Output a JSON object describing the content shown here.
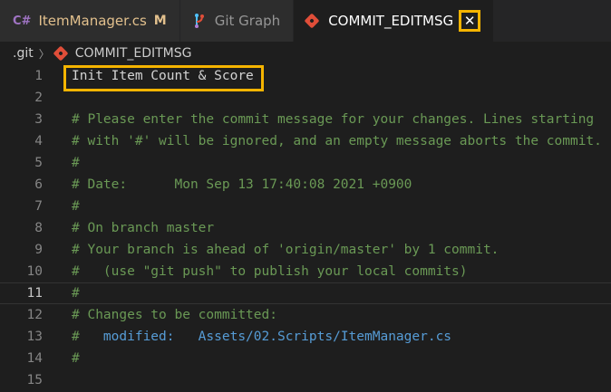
{
  "tabs": [
    {
      "icon": "C#",
      "label": "ItemManager.cs",
      "badge": "M"
    },
    {
      "label": "Git Graph"
    },
    {
      "label": "COMMIT_EDITMSG",
      "close": "✕"
    }
  ],
  "breadcrumb": {
    "folder": ".git",
    "separator": "〉",
    "file": "COMMIT_EDITMSG"
  },
  "editor": {
    "current_line": 11,
    "lines": [
      {
        "n": "1",
        "text": "Init Item Count & Score"
      },
      {
        "n": "2",
        "text": ""
      },
      {
        "n": "3",
        "text": "# Please enter the commit message for your changes. Lines starting"
      },
      {
        "n": "4",
        "text": "# with '#' will be ignored, and an empty message aborts the commit."
      },
      {
        "n": "5",
        "text": "#"
      },
      {
        "n": "6",
        "text": "# Date:      Mon Sep 13 17:40:08 2021 +0900"
      },
      {
        "n": "7",
        "text": "#"
      },
      {
        "n": "8",
        "text": "# On branch master"
      },
      {
        "n": "9",
        "text": "# Your branch is ahead of 'origin/master' by 1 commit."
      },
      {
        "n": "10",
        "text": "#   (use \"git push\" to publish your local commits)"
      },
      {
        "n": "11",
        "text": "#"
      },
      {
        "n": "12",
        "text": "# Changes to be committed:"
      },
      {
        "n": "13",
        "prefix": "#   ",
        "keyword": "modified:   Assets/02.Scripts/ItemManager.cs"
      },
      {
        "n": "14",
        "text": "#"
      },
      {
        "n": "15",
        "text": ""
      }
    ]
  },
  "colors": {
    "highlight": "#f5b400",
    "comment": "#6a9955",
    "keyword": "#569cd6",
    "git": "#e04e39"
  }
}
